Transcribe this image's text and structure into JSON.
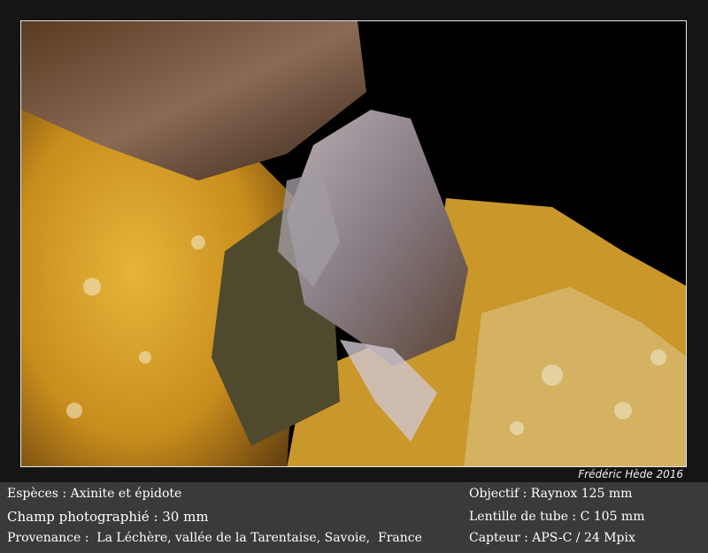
{
  "credit": "Frédéric Hède 2016",
  "captions": {
    "species": "Espèces : Axinite et épidote",
    "field": "Champ photographié : 30 mm",
    "provenance": "Provenance :  La Léchère, vallée de la Tarentaise, Savoie,  France",
    "objective": "Objectif : Raynox 125 mm",
    "tube_lens": "Lentille de tube : C 105 mm",
    "sensor": "Capteur : APS-C / 24 Mpix"
  },
  "colors": {
    "background": "#3a3a3a",
    "frame": "#151515",
    "matrix_yellow": "#d9a32a",
    "crystal": "#8a7e86"
  }
}
